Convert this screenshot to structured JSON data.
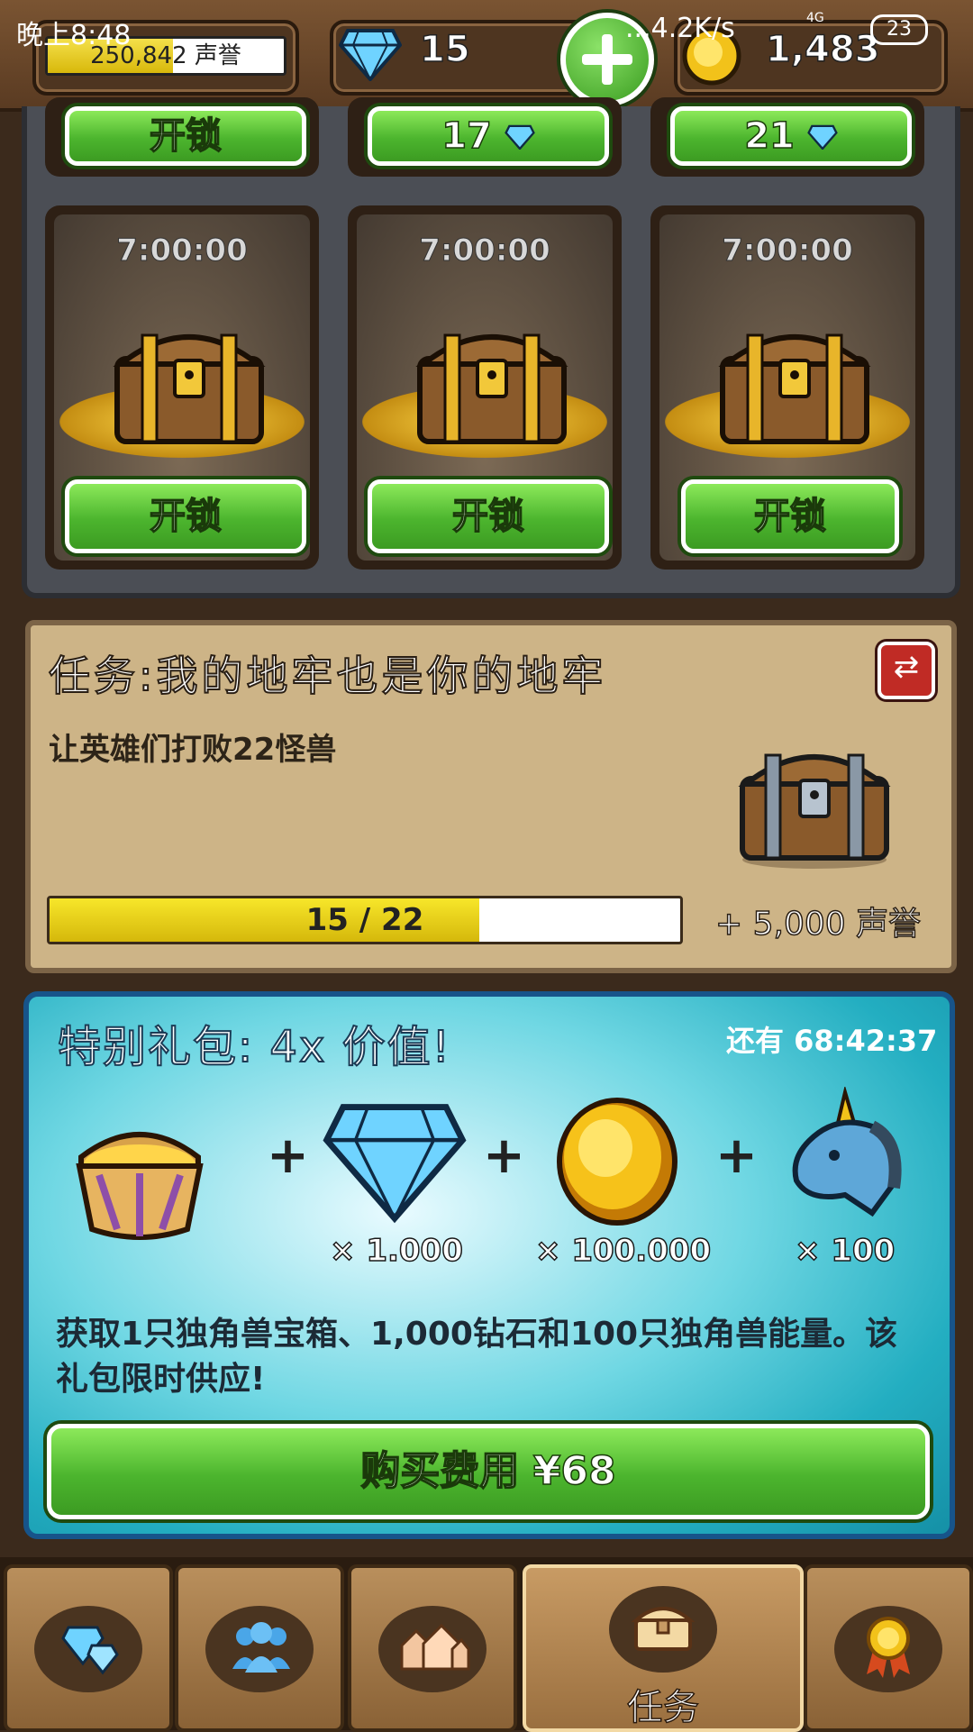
{
  "status_bar": {
    "time": "晚上8:48",
    "network": "...4.2K/s",
    "signal": "4G",
    "battery": "23"
  },
  "hud": {
    "reputation_text": "250,842 声誉",
    "reputation_fill": 0.53,
    "gems": "15",
    "gold": "1,483"
  },
  "vault": {
    "top_row_buttons": [
      "开锁",
      "17",
      "21"
    ],
    "slots": [
      {
        "timer": "7:00:00",
        "button": "开锁"
      },
      {
        "timer": "7:00:00",
        "button": "开锁"
      },
      {
        "timer": "7:00:00",
        "button": "开锁"
      }
    ]
  },
  "quest": {
    "title": "任务:我的地牢也是你的地牢",
    "description": "让英雄们打败22怪兽",
    "progress_text": "15 / 22",
    "progress_current": 15,
    "progress_total": 22,
    "reward_text": "+ 5,000 声誉"
  },
  "offer": {
    "title": "特别礼包: 4x 价值!",
    "timer": "还有 68:42:37",
    "items": [
      {
        "icon": "unicorn-chest-icon",
        "qty": ""
      },
      {
        "icon": "diamond-icon",
        "qty": "× 1.000"
      },
      {
        "icon": "gold-coin-icon",
        "qty": "× 100.000"
      },
      {
        "icon": "unicorn-head-icon",
        "qty": "× 100"
      }
    ],
    "description": "获取1只独角兽宝箱、1,000钻石和100只独角兽能量。该礼包限时供应!",
    "buy_label": "购买费用 ¥68"
  },
  "nav": {
    "tabs": [
      {
        "icon": "gems-icon",
        "label": ""
      },
      {
        "icon": "heroes-icon",
        "label": ""
      },
      {
        "icon": "dungeon-icon",
        "label": ""
      },
      {
        "icon": "chest-icon",
        "label": "任务"
      },
      {
        "icon": "medal-icon",
        "label": ""
      }
    ]
  },
  "colors": {
    "green_button": "#4cb52e",
    "offer_bg": "#23aec1",
    "quest_bg": "#cdb487",
    "wood": "#8a6236"
  }
}
